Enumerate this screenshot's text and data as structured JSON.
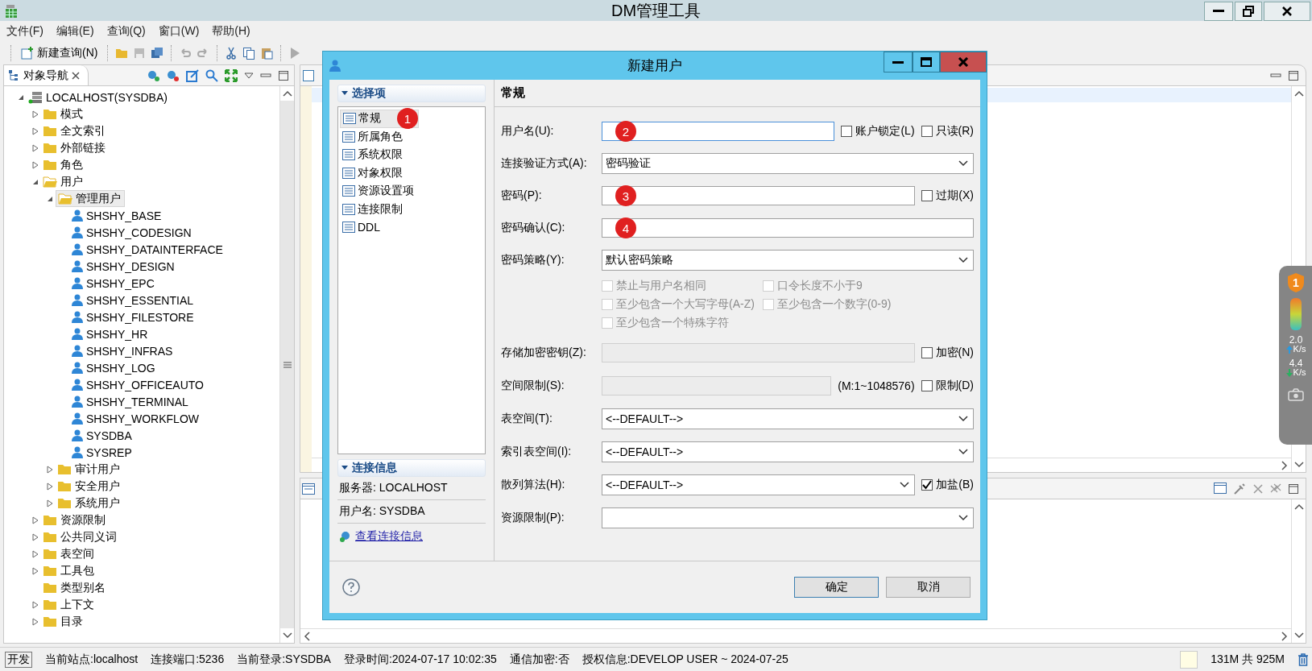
{
  "window": {
    "title": "DM管理工具"
  },
  "menu": [
    "文件(F)",
    "编辑(E)",
    "查询(Q)",
    "窗口(W)",
    "帮助(H)"
  ],
  "toolbar": {
    "new_query": "新建查询(N)"
  },
  "navigator": {
    "tab": "对象导航",
    "tree": [
      {
        "label": "LOCALHOST(SYSDBA)",
        "kind": "server",
        "expanded": true,
        "selected": false,
        "children": [
          {
            "label": "模式",
            "kind": "folder",
            "expanded": false,
            "selected": false
          },
          {
            "label": "全文索引",
            "kind": "folder",
            "expanded": false,
            "selected": false
          },
          {
            "label": "外部链接",
            "kind": "folder",
            "expanded": false,
            "selected": false
          },
          {
            "label": "角色",
            "kind": "folder",
            "expanded": false,
            "selected": false
          },
          {
            "label": "用户",
            "kind": "folder",
            "expanded": true,
            "selected": false,
            "children": [
              {
                "label": "管理用户",
                "kind": "folder",
                "expanded": true,
                "selected": true,
                "children": [
                  {
                    "label": "SHSHY_BASE",
                    "kind": "user",
                    "selected": false
                  },
                  {
                    "label": "SHSHY_CODESIGN",
                    "kind": "user",
                    "selected": false
                  },
                  {
                    "label": "SHSHY_DATAINTERFACE",
                    "kind": "user",
                    "selected": false
                  },
                  {
                    "label": "SHSHY_DESIGN",
                    "kind": "user",
                    "selected": false
                  },
                  {
                    "label": "SHSHY_EPC",
                    "kind": "user",
                    "selected": false
                  },
                  {
                    "label": "SHSHY_ESSENTIAL",
                    "kind": "user",
                    "selected": false
                  },
                  {
                    "label": "SHSHY_FILESTORE",
                    "kind": "user",
                    "selected": false
                  },
                  {
                    "label": "SHSHY_HR",
                    "kind": "user",
                    "selected": false
                  },
                  {
                    "label": "SHSHY_INFRAS",
                    "kind": "user",
                    "selected": false
                  },
                  {
                    "label": "SHSHY_LOG",
                    "kind": "user",
                    "selected": false
                  },
                  {
                    "label": "SHSHY_OFFICEAUTO",
                    "kind": "user",
                    "selected": false
                  },
                  {
                    "label": "SHSHY_TERMINAL",
                    "kind": "user",
                    "selected": false
                  },
                  {
                    "label": "SHSHY_WORKFLOW",
                    "kind": "user",
                    "selected": false
                  },
                  {
                    "label": "SYSDBA",
                    "kind": "user",
                    "selected": false
                  },
                  {
                    "label": "SYSREP",
                    "kind": "user",
                    "selected": false
                  }
                ]
              },
              {
                "label": "审计用户",
                "kind": "folder",
                "expanded": false,
                "selected": false
              },
              {
                "label": "安全用户",
                "kind": "folder",
                "expanded": false,
                "selected": false
              },
              {
                "label": "系统用户",
                "kind": "folder",
                "expanded": false,
                "selected": false
              }
            ]
          },
          {
            "label": "资源限制",
            "kind": "folder",
            "expanded": false,
            "selected": false
          },
          {
            "label": "公共同义词",
            "kind": "folder",
            "expanded": false,
            "selected": false
          },
          {
            "label": "表空间",
            "kind": "folder",
            "expanded": false,
            "selected": false
          },
          {
            "label": "工具包",
            "kind": "folder",
            "expanded": false,
            "selected": false
          },
          {
            "label": "类型别名",
            "kind": "folder",
            "selected": false
          },
          {
            "label": "上下文",
            "kind": "folder",
            "expanded": false,
            "selected": false
          },
          {
            "label": "目录",
            "kind": "folder",
            "expanded": false,
            "selected": false
          }
        ]
      }
    ]
  },
  "dialog": {
    "title": "新建用户",
    "nav_header": "选择项",
    "nav_items": [
      {
        "label": "常规",
        "selected": true,
        "marker": "1"
      },
      {
        "label": "所属角色",
        "selected": false
      },
      {
        "label": "系统权限",
        "selected": false
      },
      {
        "label": "对象权限",
        "selected": false
      },
      {
        "label": "资源设置项",
        "selected": false
      },
      {
        "label": "连接限制",
        "selected": false
      },
      {
        "label": "DDL",
        "selected": false
      }
    ],
    "conn_header": "连接信息",
    "conn_info": [
      "服务器: LOCALHOST",
      "用户名: SYSDBA"
    ],
    "conn_link": "查看连接信息",
    "section": "常规",
    "fields": [
      {
        "kind": "text",
        "label": "用户名(U):",
        "focused": true,
        "marker": "2",
        "options": [
          {
            "label": "账户锁定(L)",
            "checked": false
          },
          {
            "label": "只读(R)",
            "checked": false
          }
        ]
      },
      {
        "kind": "select",
        "label": "连接验证方式(A):",
        "value": "密码验证"
      },
      {
        "kind": "text",
        "label": "密码(P):",
        "marker": "3",
        "options": [
          {
            "label": "过期(X)",
            "checked": false
          }
        ]
      },
      {
        "kind": "text",
        "label": "密码确认(C):",
        "marker": "4"
      },
      {
        "kind": "select",
        "label": "密码策略(Y):",
        "value": "默认密码策略"
      },
      {
        "kind": "checkgrid",
        "items": [
          {
            "label": "禁止与用户名相同",
            "checked": false,
            "disabled": true
          },
          {
            "label": "口令长度不小于9",
            "checked": false,
            "disabled": true
          },
          {
            "label": "至少包含一个大写字母(A-Z)",
            "checked": false,
            "disabled": true
          },
          {
            "label": "至少包含一个数字(0-9)",
            "checked": false,
            "disabled": true
          },
          {
            "label": "至少包含一个特殊字符",
            "checked": false,
            "disabled": true
          }
        ]
      },
      {
        "kind": "text",
        "label": "存储加密密钥(Z):",
        "disabled": true,
        "options": [
          {
            "label": "加密(N)",
            "checked": false
          }
        ]
      },
      {
        "kind": "text",
        "label": "空间限制(S):",
        "disabled": true,
        "hint": "(M:1~1048576)",
        "options": [
          {
            "label": "限制(D)",
            "checked": false
          }
        ]
      },
      {
        "kind": "select",
        "label": "表空间(T):",
        "value": "<--DEFAULT-->"
      },
      {
        "kind": "select",
        "label": "索引表空间(I):",
        "value": "<--DEFAULT-->"
      },
      {
        "kind": "select",
        "label": "散列算法(H):",
        "value": "<--DEFAULT-->",
        "options": [
          {
            "label": "加盐(B)",
            "checked": true
          }
        ]
      },
      {
        "kind": "select",
        "label": "资源限制(P):"
      }
    ],
    "buttons": [
      {
        "label": "确定",
        "focused": true
      },
      {
        "label": "取消",
        "focused": false
      }
    ]
  },
  "status_bar": {
    "mode": "开发",
    "items": [
      "当前站点:localhost",
      "连接端口:5236",
      "当前登录:SYSDBA",
      "登录时间:2024-07-17 10:02:35",
      "通信加密:否",
      "授权信息:DEVELOP USER ~ 2024-07-25"
    ],
    "memory": "131M 共 925M"
  },
  "monitor": {
    "badge": "1",
    "up": {
      "value": "2.0",
      "unit": "K/s"
    },
    "down": {
      "value": "4.4",
      "unit": "K/s"
    }
  }
}
